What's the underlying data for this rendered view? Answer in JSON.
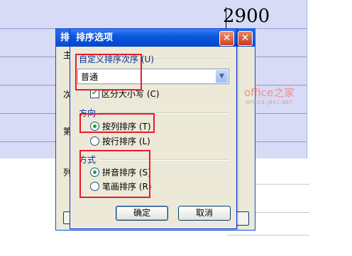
{
  "sheet": {
    "cell_value": "2900"
  },
  "back_dialog": {
    "title": "排",
    "labels": [
      "主",
      "次",
      "第",
      "列"
    ]
  },
  "dialog": {
    "title": "排序选项",
    "close_glyph": "✕",
    "custom_order": {
      "label": "自定义排序次序 (U)",
      "selected": "普通"
    },
    "case_sensitive": {
      "label": "区分大小写 (C)",
      "checked": true
    },
    "direction": {
      "label": "方向",
      "options": [
        {
          "label": "按列排序 (T)",
          "selected": true
        },
        {
          "label": "按行排序 (L)",
          "selected": false
        }
      ]
    },
    "method": {
      "label": "方式",
      "options": [
        {
          "label": "拼音排序 (S)",
          "selected": true
        },
        {
          "label": "笔画排序 (R)",
          "selected": false
        }
      ]
    },
    "ok_label": "确定",
    "cancel_label": "取消"
  },
  "watermark": {
    "brand": "office之家",
    "url": "OFFICE.JB51.NET"
  },
  "colors": {
    "highlight": "#e8192c",
    "titlebar": "#0a58e0"
  }
}
